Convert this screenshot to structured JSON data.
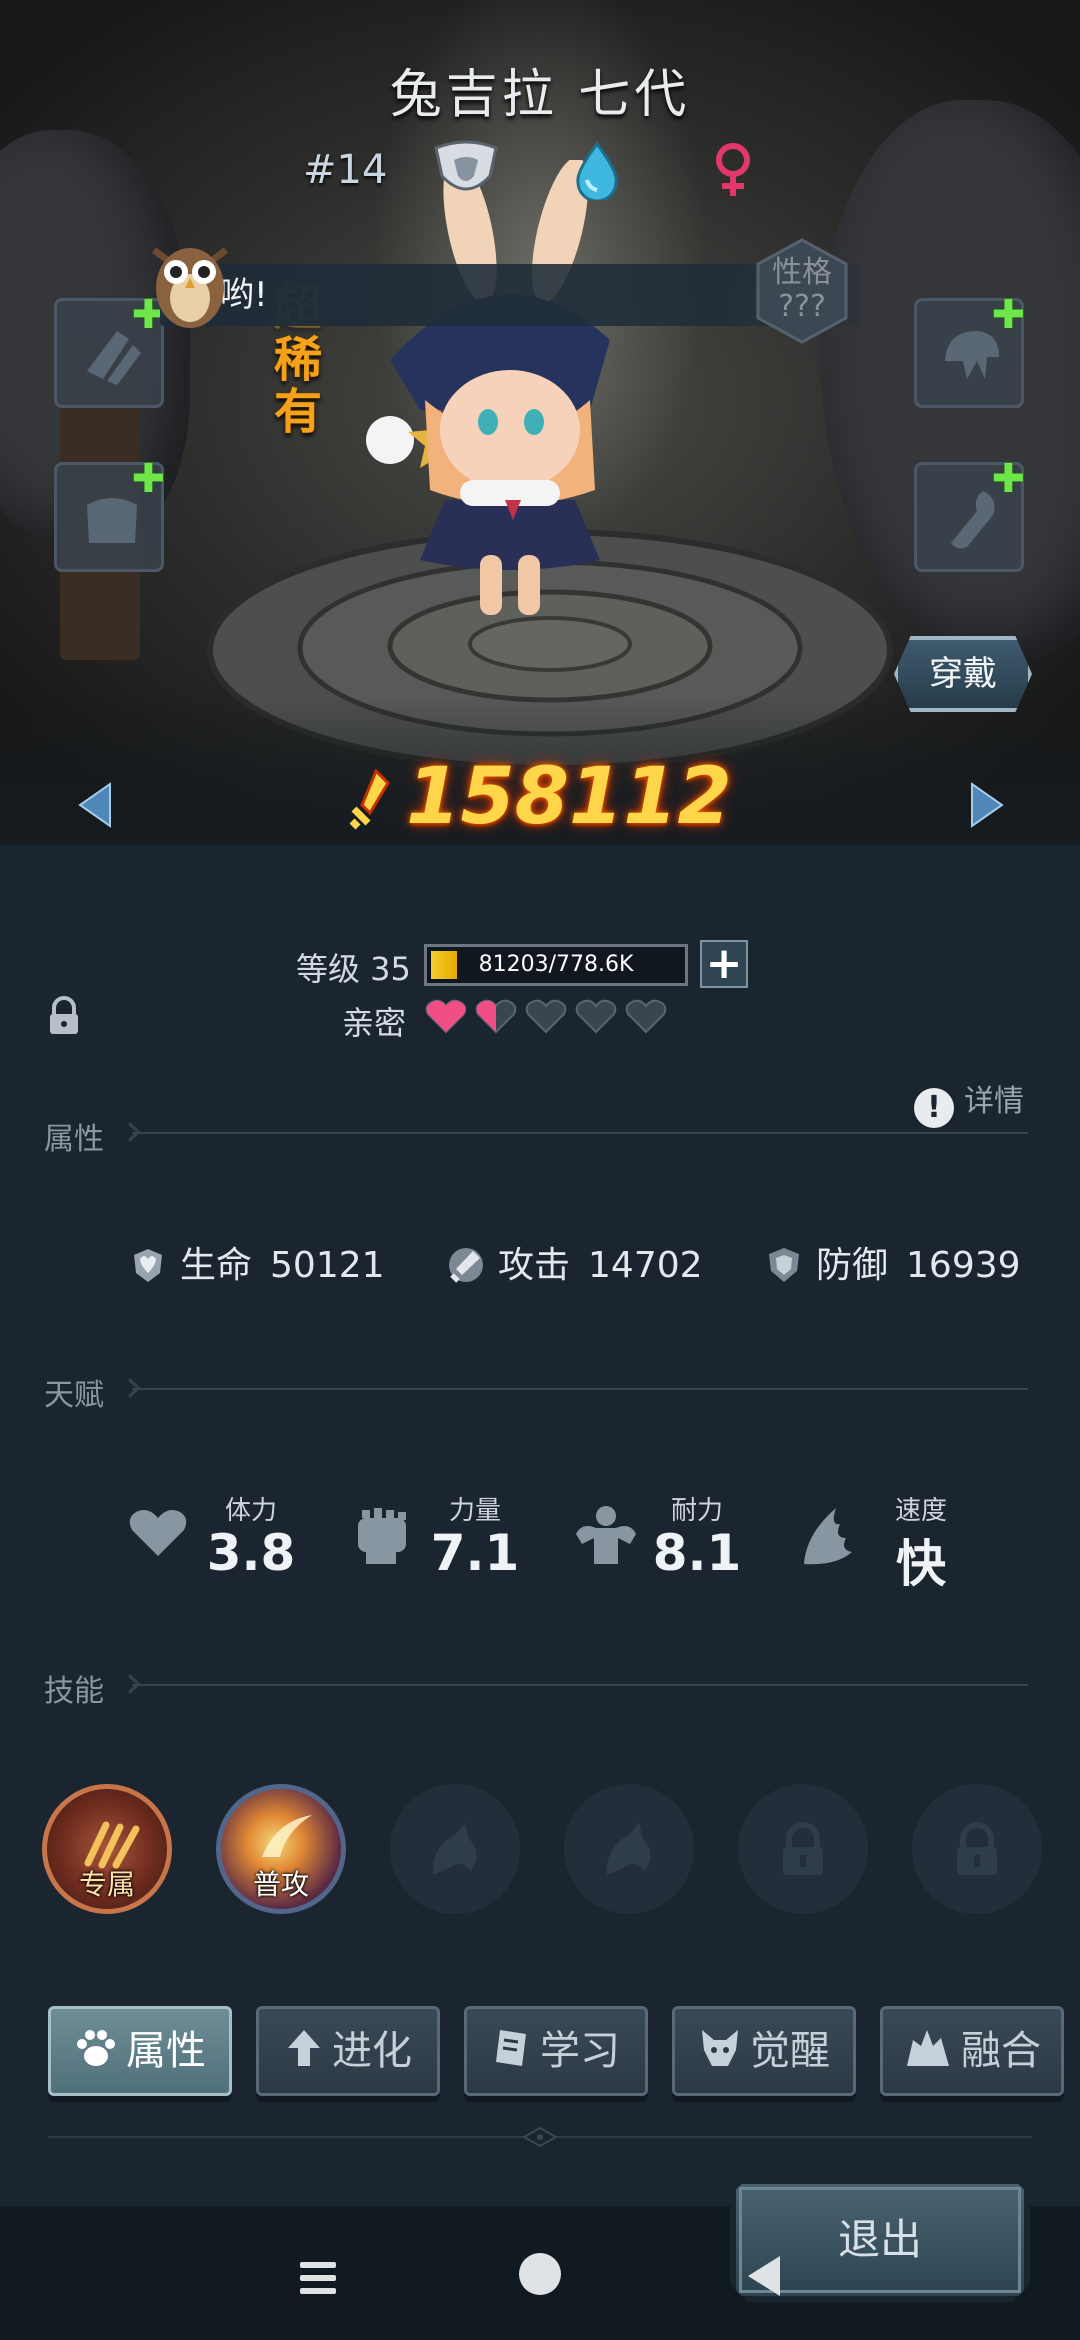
{
  "hero": {
    "name": "兔吉拉 七代",
    "index": "#14",
    "rarity": "超稀有",
    "speech": "哟!",
    "trait_label": "性格\n???",
    "wear_label": "穿戴",
    "power": "158112"
  },
  "level": {
    "label": "等级 35",
    "xp": "81203/778.6K",
    "xp_fraction": 0.104
  },
  "intimacy": {
    "label": "亲密",
    "hearts": [
      1,
      0.5,
      0,
      0,
      0
    ]
  },
  "sections": {
    "attributes": "属性",
    "talent": "天赋",
    "skills": "技能",
    "details": "详情"
  },
  "stats": [
    {
      "name": "生命",
      "value": "50121",
      "icon": "heart-shield-icon"
    },
    {
      "name": "攻击",
      "value": "14702",
      "icon": "sword-icon"
    },
    {
      "name": "防御",
      "value": "16939",
      "icon": "shield-icon"
    }
  ],
  "talents": [
    {
      "name": "体力",
      "value": "3.8",
      "icon": "heart-icon"
    },
    {
      "name": "力量",
      "value": "7.1",
      "icon": "fist-icon"
    },
    {
      "name": "耐力",
      "value": "8.1",
      "icon": "muscle-icon"
    },
    {
      "name": "速度",
      "value": "快",
      "icon": "wing-icon"
    }
  ],
  "skills": [
    {
      "caption": "专属",
      "state": "exclusive"
    },
    {
      "caption": "普攻",
      "state": "normal"
    },
    {
      "caption": "",
      "state": "empty"
    },
    {
      "caption": "",
      "state": "empty"
    },
    {
      "caption": "",
      "state": "locked"
    },
    {
      "caption": "",
      "state": "locked"
    }
  ],
  "tabs": [
    {
      "label": "属性",
      "icon": "paw-icon",
      "active": true
    },
    {
      "label": "进化",
      "icon": "evolve-arrow-icon",
      "active": false
    },
    {
      "label": "学习",
      "icon": "book-icon",
      "active": false
    },
    {
      "label": "觉醒",
      "icon": "beast-head-icon",
      "active": false
    },
    {
      "label": "融合",
      "icon": "merge-icon",
      "active": false
    }
  ],
  "exit_label": "退出",
  "colors": {
    "power": "#ffd64a",
    "rarity": "#f5a21a",
    "heart_full": "#ef4f86",
    "heart_empty": "#3a4550",
    "plus_green": "#6ee64a"
  }
}
